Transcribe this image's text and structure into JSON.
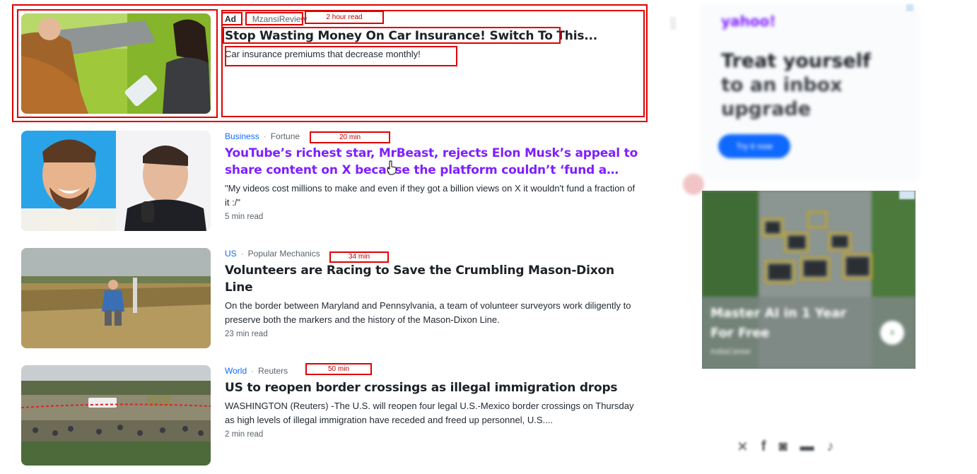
{
  "sponsored": {
    "ad_label": "Ad",
    "source": "MzansiReview",
    "time_annotation": "2 hour read",
    "title": "Stop Wasting Money On Car Insurance! Switch To This...",
    "summary": "Car insurance premiums that decrease monthly!"
  },
  "stories": [
    {
      "category": "Business",
      "source": "Fortune",
      "time_annotation": "20 min",
      "title": "YouTube’s richest star, MrBeast, rejects Elon Musk’s appeal to share content on X because the platform couldn’t ‘fund a fraction’ of his...",
      "summary": "\"My videos cost millions to make and even if they got a billion views on X it wouldn't fund a fraction of it :/\"",
      "read_time": "5 min read",
      "visited": true
    },
    {
      "category": "US",
      "source": "Popular Mechanics",
      "time_annotation": "34 min",
      "title": "Volunteers are Racing to Save the Crumbling Mason-Dixon Line",
      "summary": "On the border between Maryland and Pennsylvania, a team of volunteer surveyors work diligently to preserve both the markers and the history of the Mason-Dixon Line.",
      "read_time": "23 min read",
      "visited": false
    },
    {
      "category": "World",
      "source": "Reuters",
      "time_annotation": "50 min",
      "title": "US to reopen border crossings as illegal immigration drops",
      "summary": "WASHINGTON (Reuters) -The U.S. will reopen four legal U.S.-Mexico border crossings on Thursday as high levels of illegal immigration have receded and freed up personnel, U.S....",
      "read_time": "2 min read",
      "visited": false
    }
  ],
  "sidebar": {
    "promo_brand": "yahoo!",
    "promo_line1": "Treat yourself",
    "promo_line2": "to an inbox",
    "promo_line3": "upgrade",
    "promo_button": "Try it now",
    "photo_caption": "Master AI in 1 Year For Free",
    "photo_source": "IndiaCareer",
    "photo_arrow": "›",
    "social_icons": [
      "x-icon",
      "facebook-icon",
      "instagram-icon",
      "youtube-icon",
      "tiktok-icon"
    ]
  },
  "colors": {
    "link_blue": "#0f69ff",
    "visited_purple": "#7e1fff",
    "annotation_red": "#e00000"
  }
}
